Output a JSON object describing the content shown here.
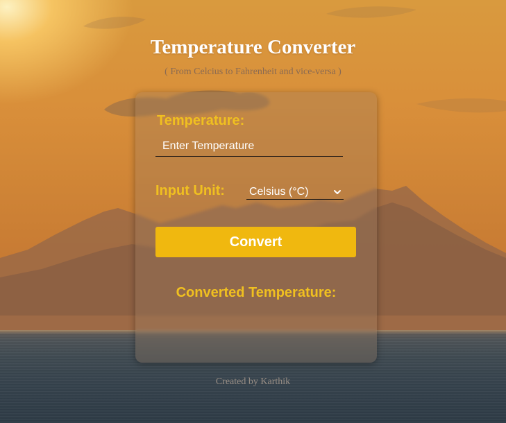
{
  "header": {
    "title": "Temperature Converter",
    "subtitle": "( From Celcius to Fahrenheit and vice-versa )"
  },
  "form": {
    "temperature_label": "Temperature:",
    "temperature_placeholder": "Enter Temperature",
    "temperature_value": "",
    "unit_label": "Input Unit:",
    "unit_selected": "Celsius (°C)",
    "convert_label": "Convert",
    "result_label": "Converted Temperature:",
    "result_value": ""
  },
  "footer": {
    "credit": "Created by Karthik"
  },
  "icons": {
    "unit_dropdown": "chevron-down-icon"
  },
  "colors": {
    "accent": "#f0b80f",
    "label": "#f0c020",
    "title": "#ffffff"
  }
}
